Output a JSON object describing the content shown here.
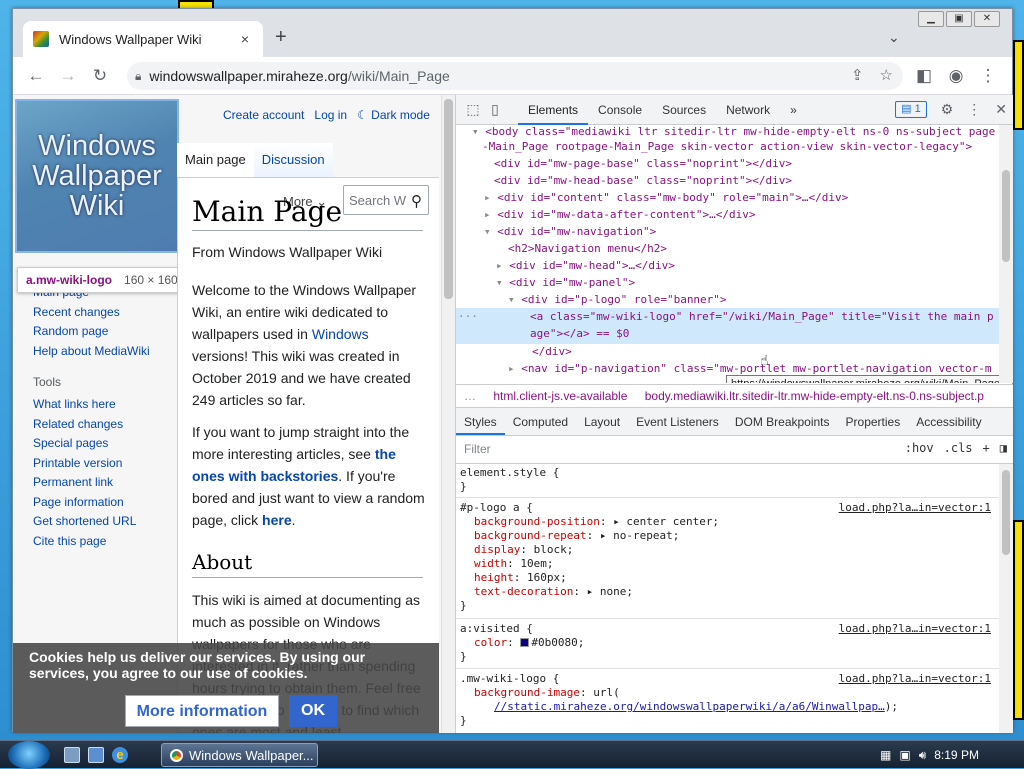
{
  "browser": {
    "tab_title": "Windows Wallpaper Wiki",
    "tab_close": "×",
    "new_tab": "+",
    "url_host": "windowswallpaper.miraheze.org",
    "url_path": "/wiki/Main_Page",
    "window_controls": [
      "▁",
      "▣",
      "✕"
    ],
    "tab_list": "⌄"
  },
  "wiki": {
    "logo_text": "Windows Wallpaper Wiki",
    "logo_tooltip": {
      "name": "a.mw-wiki-logo",
      "size": "160 × 160"
    },
    "user_links": [
      "Create account",
      "Log in",
      "☾ Dark mode"
    ],
    "tabs": [
      "Main page",
      "Discussion"
    ],
    "more_label": "More ⌄",
    "search_placeholder": "Search W",
    "nav": [
      "Main page",
      "Recent changes",
      "Random page",
      "Help about MediaWiki"
    ],
    "tools_heading": "Tools",
    "tools": [
      "What links here",
      "Related changes",
      "Special pages",
      "Printable version",
      "Permanent link",
      "Page information",
      "Get shortened URL",
      "Cite this page"
    ],
    "title": "Main Page",
    "from": "From Windows Wallpaper Wiki",
    "p1_a": "Welcome to the Windows Wallpaper Wiki, an entire wiki dedicated to wallpapers used in ",
    "p1_link": "Windows",
    "p1_b": " versions! This wiki was created in October 2019 and we have created 249 articles so far.",
    "p2_a": "If you want to jump straight into the more interesting articles, see ",
    "p2_link": "the ones with backstories",
    "p2_b": ". If you're bored and just want to view a random page, click ",
    "p2_link2": "here",
    "p2_c": ".",
    "about": "About",
    "about_text": "This wiki is aimed at documenting as much as possible on Windows wallpapers for those who are interested in it, rather than spending hours trying to obtain them. Feel free to contribute to this wiki to find which ones are most and least",
    "cookie_msg": "Cookies help us deliver our services. By using our services, you agree to our use of cookies.",
    "cookie_more": "More information",
    "cookie_ok": "OK"
  },
  "devtools": {
    "tabs": [
      "Elements",
      "Console",
      "Sources",
      "Network",
      "»"
    ],
    "issues_badge": "1",
    "dom_lines": [
      "<body class=\"mediawiki ltr sitedir-ltr mw-hide-empty-elt ns-0 ns-subject page",
      "-Main_Page rootpage-Main_Page skin-vector action-view skin-vector-legacy\">",
      "<div id=\"mw-page-base\" class=\"noprint\"></div>",
      "<div id=\"mw-head-base\" class=\"noprint\"></div>",
      "<div id=\"content\" class=\"mw-body\" role=\"main\">…</div>",
      "<div id=\"mw-data-after-content\">…</div>",
      "<div id=\"mw-navigation\">",
      "<h2>Navigation menu</h2>",
      "<div id=\"mw-head\">…</div>",
      "<div id=\"mw-panel\">",
      "<div id=\"p-logo\" role=\"banner\">",
      "<a class=\"mw-wiki-logo\" href=\"/wiki/Main_Page\" title=\"Visit the main p",
      "age\"></a> == $0",
      "</div>",
      "<nav id=\"p-navigation\" class=\"mw-portlet mw-portlet-navigation vector-m"
    ],
    "link_tooltip": "https://windowswallpaper.miraheze.org/wiki/Main_Page",
    "breadcrumbs": [
      "html.client-js.ve-available",
      "body.mediawiki.ltr.sitedir-ltr.mw-hide-empty-elt.ns-0.ns-subject.p"
    ],
    "style_tabs": [
      "Styles",
      "Computed",
      "Layout",
      "Event Listeners",
      "DOM Breakpoints",
      "Properties",
      "Accessibility"
    ],
    "filter_placeholder": "Filter",
    "filter_tools": [
      ":hov",
      ".cls",
      "+"
    ],
    "source": "load.php?la…in=vector:1",
    "rules": {
      "element_style": "element.style {",
      "r1_sel": "#p-logo a {",
      "r1": [
        [
          "background-position",
          "center center;"
        ],
        [
          "background-repeat",
          "no-repeat;"
        ],
        [
          "display",
          "block;"
        ],
        [
          "width",
          "10em;"
        ],
        [
          "height",
          "160px;"
        ],
        [
          "text-decoration",
          "none;"
        ]
      ],
      "r2_sel": "a:visited {",
      "r2_prop": "color",
      "r2_val": "#0b0080;",
      "r3_sel": ".mw-wiki-logo {",
      "r3_prop": "background-image",
      "r3_val": "url(",
      "r3_url": "//static.miraheze.org/windowswallpaperwiki/a/a6/Winwallpap…",
      "r3_end": ");",
      "close": "}"
    }
  },
  "taskbar": {
    "item": "Windows Wallpaper...",
    "clock": "8:19 PM"
  },
  "colors": {
    "accent": "#1a73e8",
    "link": "#0645ad",
    "visited": "#0b0080"
  }
}
